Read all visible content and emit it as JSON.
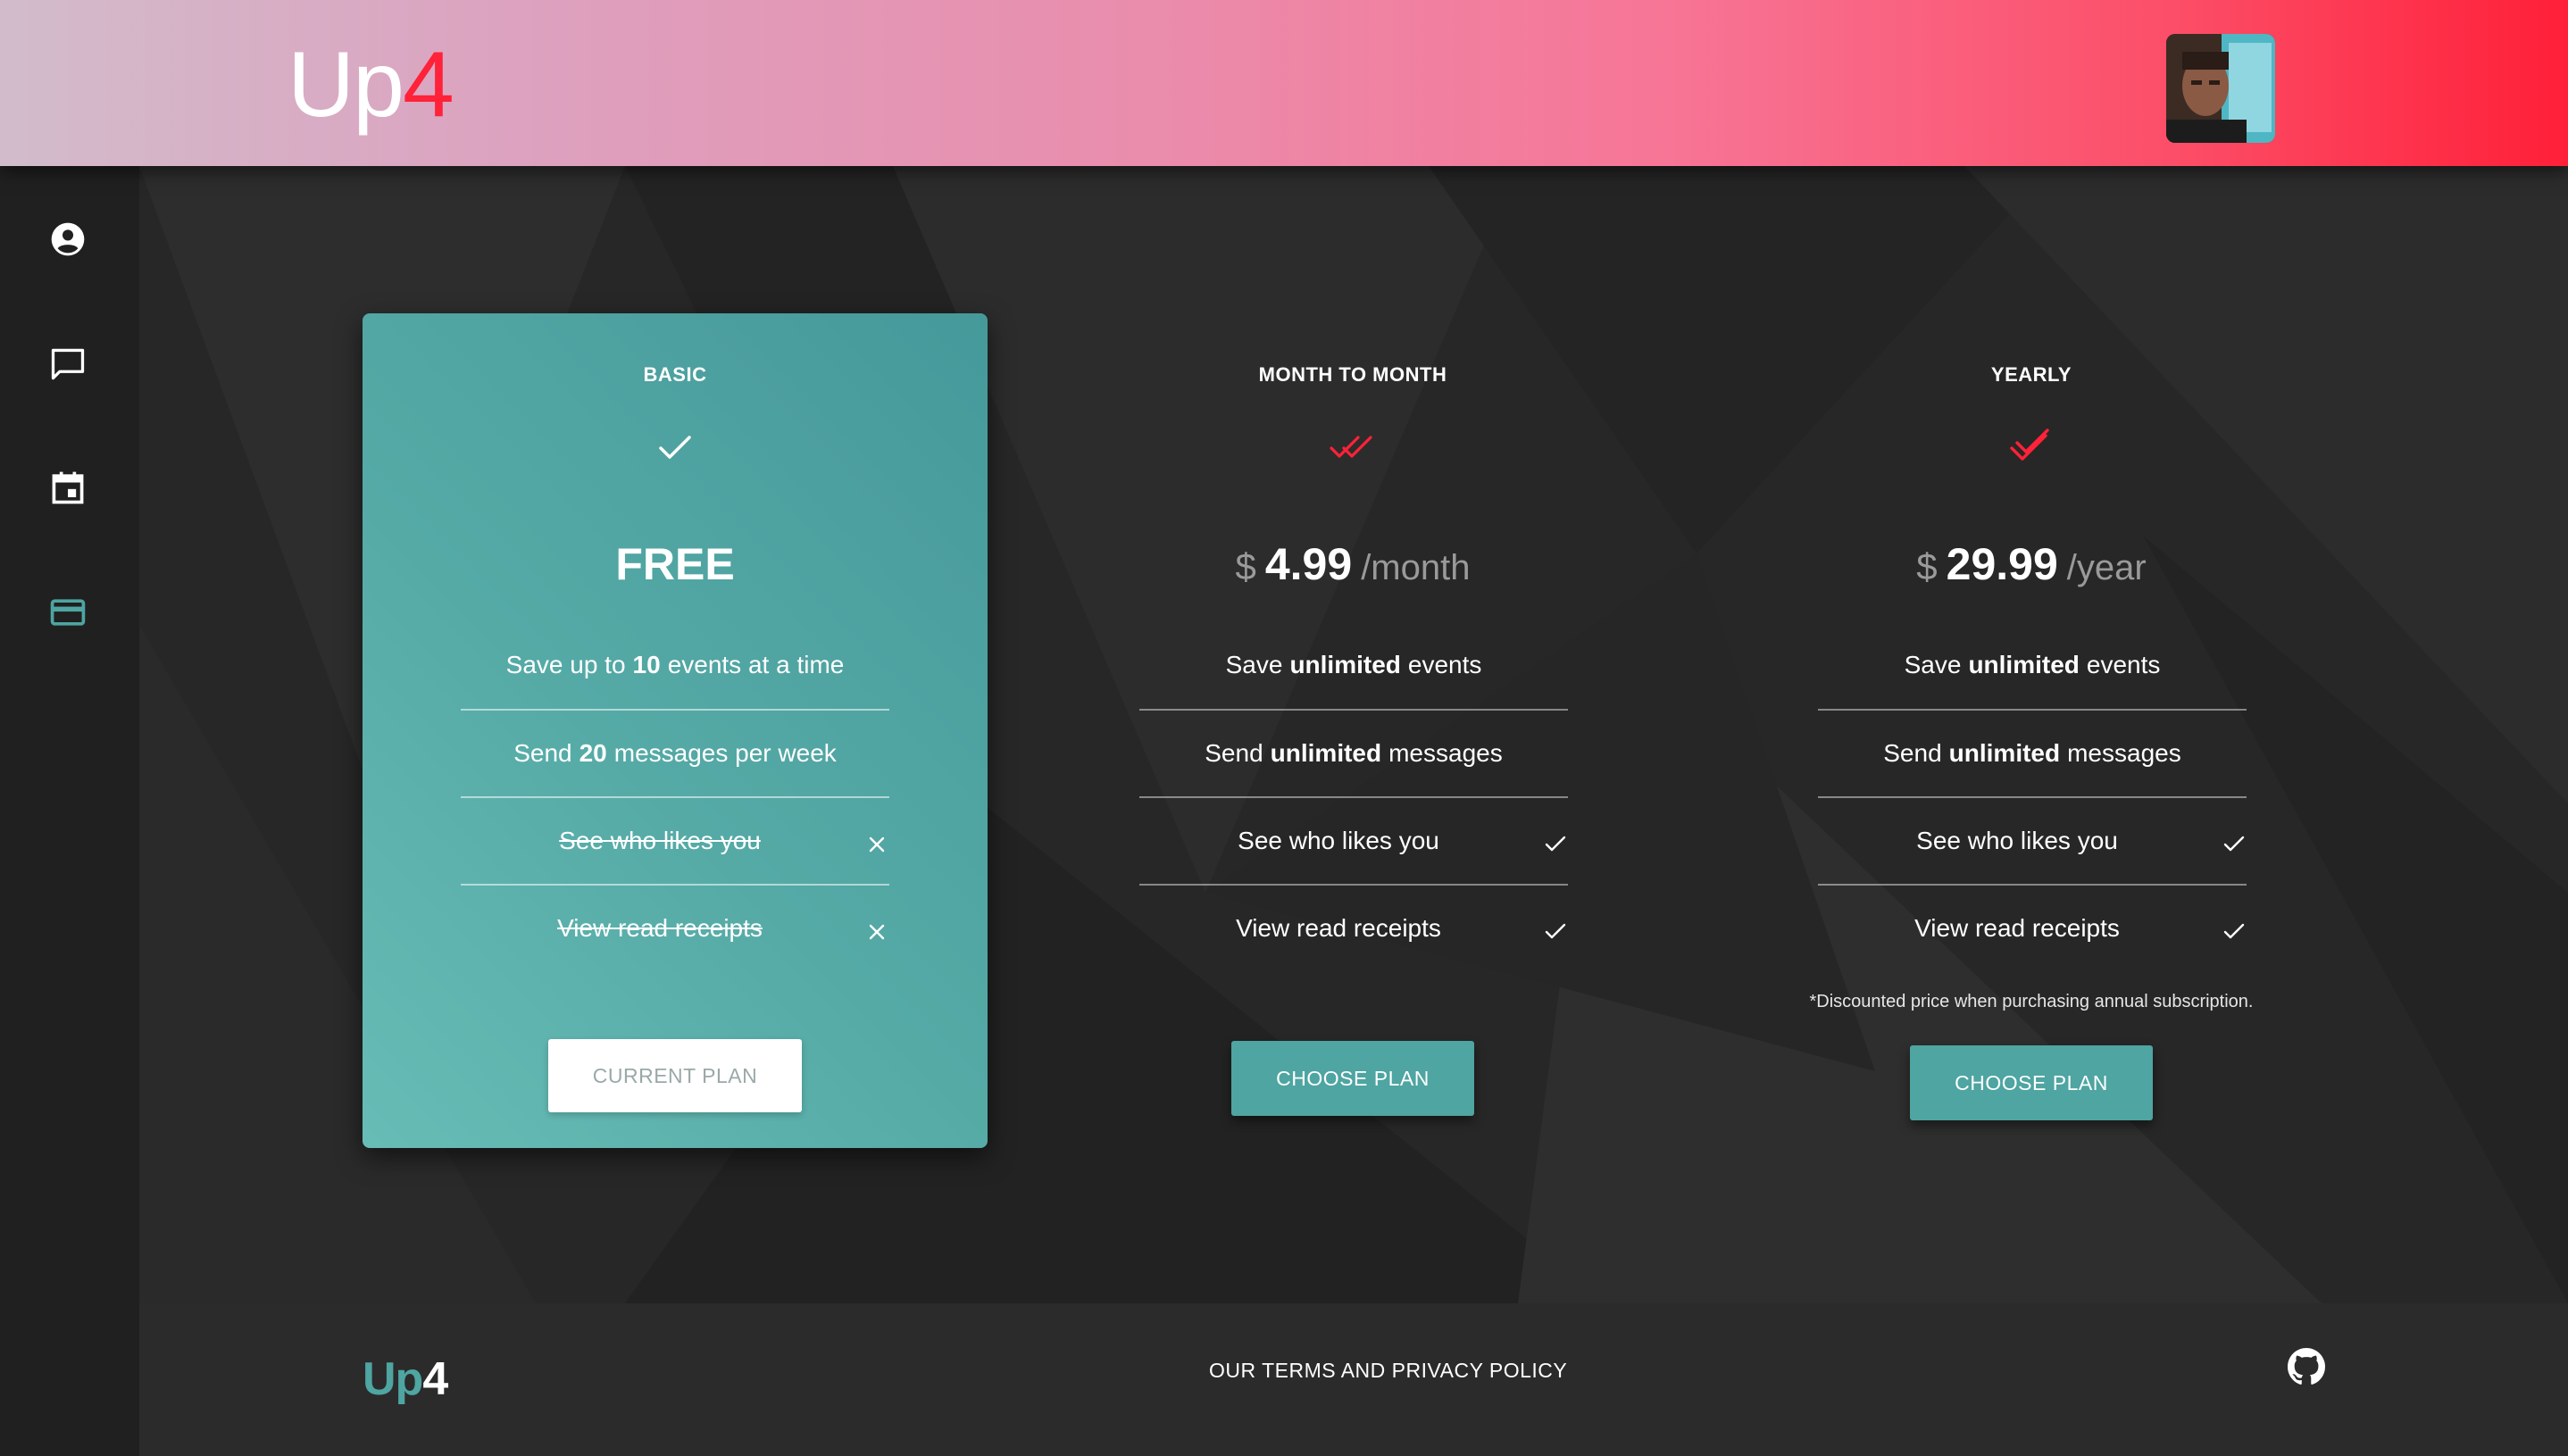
{
  "header": {
    "logo_main": "Up",
    "logo_accent": "4"
  },
  "sidebar": {
    "items": [
      {
        "name": "profile",
        "icon": "account-circle-icon",
        "active": false
      },
      {
        "name": "messages",
        "icon": "chat-icon",
        "active": false
      },
      {
        "name": "events",
        "icon": "calendar-icon",
        "active": false
      },
      {
        "name": "subscription",
        "icon": "credit-card-icon",
        "active": true
      }
    ]
  },
  "plans": [
    {
      "title": "BASIC",
      "price_label": "FREE",
      "features": [
        {
          "pre": "Save up to",
          "bold": "10",
          "post": "events at a time"
        },
        {
          "pre": "Send",
          "bold": "20",
          "post": "messages per week"
        },
        {
          "text": "See who likes you",
          "included": false
        },
        {
          "text": "View read receipts",
          "included": false
        }
      ],
      "button": "CURRENT PLAN"
    },
    {
      "title": "MONTH TO MONTH",
      "currency": "$",
      "amount": "4.99",
      "period": "/month",
      "features": [
        {
          "pre": "Save",
          "bold": "unlimited",
          "post": "events"
        },
        {
          "pre": "Send",
          "bold": "unlimited",
          "post": "messages"
        },
        {
          "text": "See who likes you",
          "included": true
        },
        {
          "text": "View read receipts",
          "included": true
        }
      ],
      "button": "CHOOSE PLAN"
    },
    {
      "title": "YEARLY",
      "currency": "$",
      "amount": "29.99",
      "period": "/year",
      "features": [
        {
          "pre": "Save",
          "bold": "unlimited",
          "post": "events"
        },
        {
          "pre": "Send",
          "bold": "unlimited",
          "post": "messages"
        },
        {
          "text": "See who likes you",
          "included": true
        },
        {
          "text": "View read receipts",
          "included": true
        }
      ],
      "note": "*Discounted price when purchasing annual subscription.",
      "button": "CHOOSE PLAN"
    }
  ],
  "footer": {
    "logo_main": "Up",
    "logo_accent": "4",
    "link": "OUR TERMS AND PRIVACY POLICY",
    "icon": "github-icon"
  },
  "colors": {
    "accent_red": "#ff2238",
    "teal": "#4ea5a2",
    "background": "#282828"
  }
}
